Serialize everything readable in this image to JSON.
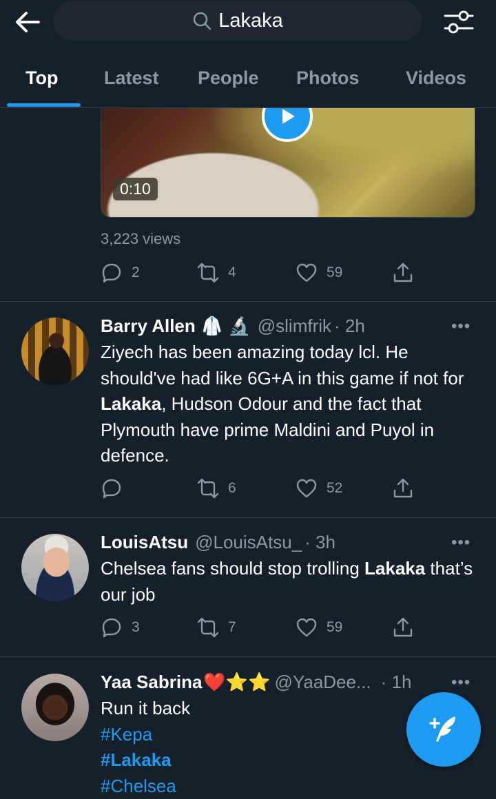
{
  "search": {
    "query": "Lakaka"
  },
  "tabs": [
    {
      "label": "Top"
    },
    {
      "label": "Latest"
    },
    {
      "label": "People"
    },
    {
      "label": "Photos"
    },
    {
      "label": "Videos"
    }
  ],
  "media_tweet": {
    "duration": "0:10",
    "views": "3,223 views",
    "replies": "2",
    "retweets": "4",
    "likes": "59"
  },
  "tweets": [
    {
      "name": "Barry Allen",
      "emoji": "🥼 🔬",
      "handle": "@slimfrik",
      "time": "· 2h",
      "text_parts": [
        "Ziyech has been amazing today lcl. He should've had like 6G+A in this game if not for ",
        "Lakaka",
        ", Hudson Odour and the fact that Plymouth have prime Maldini and Puyol in defence."
      ],
      "replies": "",
      "retweets": "6",
      "likes": "52"
    },
    {
      "name": "LouisAtsu",
      "handle": "@LouisAtsu_",
      "time": "· 3h",
      "text_parts": [
        "Chelsea fans should stop trolling ",
        "Lakaka",
        " that’s our job"
      ],
      "replies": "3",
      "retweets": "7",
      "likes": "59"
    },
    {
      "name": "Yaa Sabrina",
      "emoji": "❤️⭐⭐",
      "handle": "@YaaDee...",
      "time": "· 1h",
      "text": "Run it back",
      "hashtags": [
        "#Kepa",
        "#Lakaka",
        "#Chelsea"
      ]
    }
  ],
  "icons": [
    "back-arrow-icon",
    "search-icon",
    "filter-icon",
    "play-icon",
    "reply-icon",
    "retweet-icon",
    "like-icon",
    "share-icon",
    "more-icon",
    "compose-icon"
  ],
  "colors": {
    "background": "#15202b",
    "accent": "#1d9bf0",
    "muted": "#8b98a5",
    "divider": "#38444d"
  }
}
